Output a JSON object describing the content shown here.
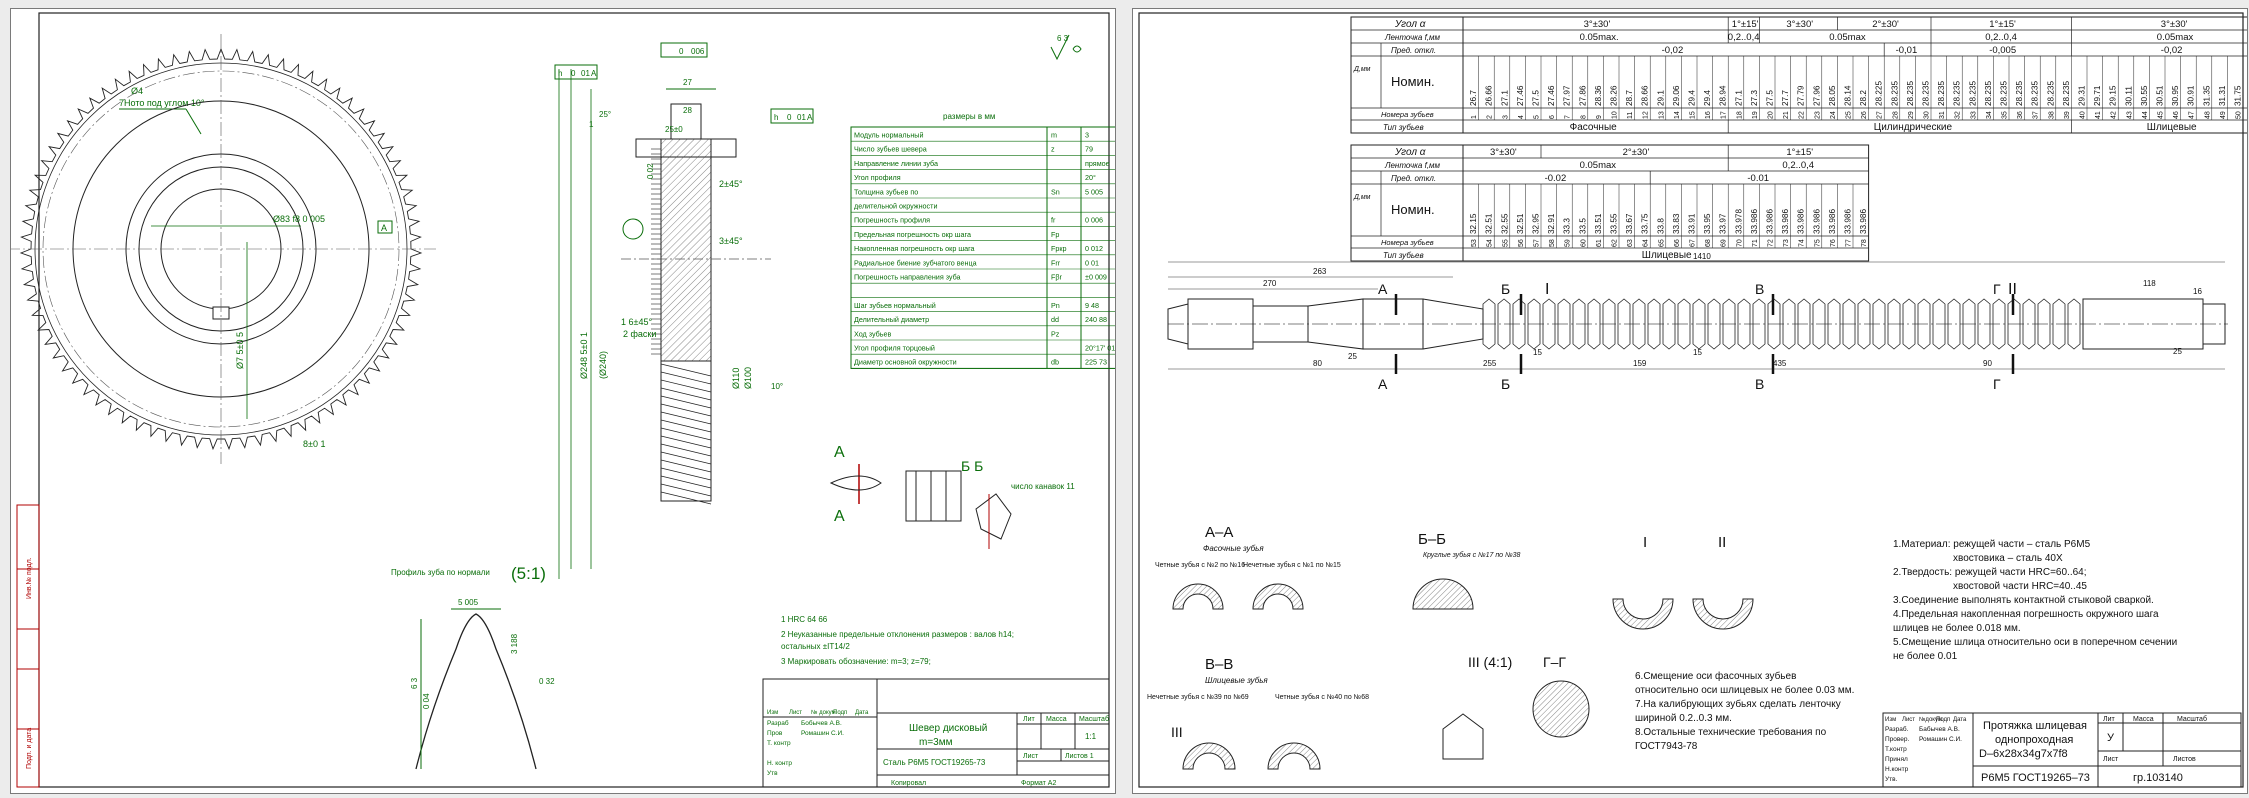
{
  "left_sheet": {
    "top_annotations": {
      "tooth_note": [
        "Ø4",
        "7Ното  под углом 10°"
      ],
      "tol_frame_1": [
        "h",
        "0",
        "01",
        "A"
      ],
      "tol_frame_2": [
        "",
        "0",
        "006"
      ],
      "tol_frame_3": [
        "h",
        "0",
        "01",
        "A"
      ],
      "dims": [
        "27",
        "28",
        "25±0",
        "1",
        "1",
        "25°"
      ]
    },
    "gear_dims": {
      "bore": "Ø83  f8  0  005",
      "datum": "A",
      "hub": "Ø7  5±0  5",
      "key": "8±0  1",
      "outer_a": "Ø248  5±0  1",
      "outer_b": "(Ø240)",
      "inner_a": "Ø110",
      "inner_b": "Ø100",
      "chamf1": "2±45°",
      "chamf2": "3±45°",
      "chamf3": "1  6±45°",
      "chamf4": "2 фаски",
      "side": "0  02",
      "angle": "10°"
    },
    "params": {
      "header": "размеры в мм",
      "rows": [
        [
          "Модуль нормальный",
          "m",
          "3"
        ],
        [
          "Число зубьев шевера",
          "z",
          "79"
        ],
        [
          "Направление линии зуба",
          "",
          "прямое"
        ],
        [
          "Угол профиля",
          "",
          "20°"
        ],
        [
          "Толщина зубьев   по",
          "Sn",
          "5   005"
        ],
        [
          "делительной окружности",
          "",
          ""
        ],
        [
          "Погрешность профиля",
          "fr",
          "0   006"
        ],
        [
          "Предельная погрешность окр   шага",
          "Fp",
          ""
        ],
        [
          "Накопленная погрешность окр   шага",
          "Fpкр",
          "0   012"
        ],
        [
          "Радиальное биение зубчатого венца",
          "Frr",
          "0   01"
        ],
        [
          "Погрешность направления зуба",
          "Fβr",
          "±0   009"
        ],
        [
          "",
          "",
          ""
        ],
        [
          "Шаг зубьев нормальный",
          "Pn",
          "9   48"
        ],
        [
          "Делительный диаметр",
          "dd",
          "240   88"
        ],
        [
          "Ход зубьев",
          "Pz",
          ""
        ],
        [
          "Угол профиля торцовый",
          "",
          "20°17'   01''"
        ],
        [
          "Диаметр основной окружности",
          "db",
          "225   73"
        ]
      ]
    },
    "section_labels": {
      "a": "А",
      "a2": "А",
      "bb": "Б  Б",
      "slots": "число канавок 11"
    },
    "notes": [
      "1    HRC  64       66",
      "2    Неуказанные предельные отклонения размеров : валов  h14;",
      "      остальных  ±IT14/2",
      "3    Маркировать обозначение: m=3; z=79;"
    ],
    "profile": {
      "title": "Профиль зуба по нормали",
      "scale": "(5:1)",
      "thick": "5   005",
      "h1": "3   188",
      "h2": "6   3",
      "r1": "0   32",
      "r2": "0   04"
    },
    "titleblock": {
      "cols": [
        "Изм",
        "Лист",
        "№ докум",
        "Подп",
        "Дата"
      ],
      "people": [
        [
          "Разраб",
          "Бобычев А.В."
        ],
        [
          "Пров",
          "Ромашин С.И."
        ],
        [
          "Т. контр",
          ""
        ],
        [
          "",
          ""
        ],
        [
          "Н. контр",
          ""
        ],
        [
          "Утв",
          ""
        ]
      ],
      "title1": "Шевер дисковый",
      "title2": "m=3мм",
      "std": "Сталь  Р6М5  ГОСТ19265-73",
      "lit": "Лит",
      "mass": "Масса",
      "scale_h": "Масштаб",
      "scale_v": "1:1",
      "sheet": "Лист",
      "sheets": "Листов  1",
      "copied": "Копировал",
      "format": "Формат  А2"
    },
    "rough": "6 3"
  },
  "right_sheet": {
    "table1": {
      "row_angle_label": "Угол α",
      "angle_vals": [
        "3°±30'",
        "1°±15'",
        "3°±30'",
        "2°±30'",
        "1°±15'",
        "3°±30'"
      ],
      "row_band_label": "Ленточка f,мм",
      "band_vals": [
        "0.05max.",
        "0,2..0,4",
        "0.05max",
        "0,2..0,4",
        "0.05max"
      ],
      "row_tol_label": "Пред. откл.",
      "tol_vals": [
        "-0,02",
        "-0,01",
        "-0,005",
        "-0,02"
      ],
      "dmm": "Д,мм",
      "nom": "Номин.",
      "row_num_label": "Номера зубьев",
      "row_type_label": "Тип зубьев",
      "types": [
        "Фасочные",
        "Цилиндрические",
        "Шлицевые"
      ],
      "cols": [
        [
          "1",
          "26.7"
        ],
        [
          "2",
          "26.66"
        ],
        [
          "3",
          "27.1"
        ],
        [
          "4",
          "27.46"
        ],
        [
          "5",
          "27.5"
        ],
        [
          "6",
          "27.46"
        ],
        [
          "7",
          "27.97"
        ],
        [
          "8",
          "27.86"
        ],
        [
          "9",
          "28.36"
        ],
        [
          "10",
          "28.26"
        ],
        [
          "11",
          "28.7"
        ],
        [
          "12",
          "28.66"
        ],
        [
          "13",
          "29.1"
        ],
        [
          "14",
          "29.06"
        ],
        [
          "15",
          "29.4"
        ],
        [
          "16",
          "29.4"
        ],
        [
          "17",
          "28.94"
        ],
        [
          "18",
          "27.1"
        ],
        [
          "19",
          "27.3"
        ],
        [
          "20",
          "27.5"
        ],
        [
          "21",
          "27.7"
        ],
        [
          "22",
          "27.79"
        ],
        [
          "23",
          "27.96"
        ],
        [
          "24",
          "28.05"
        ],
        [
          "25",
          "28.14"
        ],
        [
          "26",
          "28.2"
        ],
        [
          "27",
          "28.225"
        ],
        [
          "28",
          "28.235"
        ],
        [
          "29",
          "28.235"
        ],
        [
          "30",
          "28.235"
        ],
        [
          "31",
          "28.235"
        ],
        [
          "32",
          "28.235"
        ],
        [
          "33",
          "28.235"
        ],
        [
          "34",
          "28.235"
        ],
        [
          "35",
          "28.235"
        ],
        [
          "36",
          "28.235"
        ],
        [
          "37",
          "28.235"
        ],
        [
          "38",
          "28.235"
        ],
        [
          "39",
          "28.235"
        ],
        [
          "40",
          "29.31"
        ],
        [
          "41",
          "29.71"
        ],
        [
          "42",
          "29.15"
        ],
        [
          "43",
          "30.11"
        ],
        [
          "44",
          "30.55"
        ],
        [
          "45",
          "30.51"
        ],
        [
          "46",
          "30.95"
        ],
        [
          "47",
          "30.91"
        ],
        [
          "48",
          "31.35"
        ],
        [
          "49",
          "31.31"
        ],
        [
          "50",
          "31.75"
        ],
        [
          "51",
          "31.71"
        ],
        [
          "52",
          "32.11"
        ]
      ]
    },
    "table2": {
      "row_angle_label": "Угол α",
      "angle_vals": [
        "3°±30'",
        "2°±30'",
        "1°±15'"
      ],
      "row_band_label": "Ленточка f,мм",
      "band_vals": [
        "0.05max",
        "0,2..0,4"
      ],
      "row_tol_label": "Пред. откл.",
      "tol_vals": [
        "-0.02",
        "-0.01"
      ],
      "dmm": "Д,мм",
      "nom": "Номин.",
      "row_num_label": "Номера зубьев",
      "row_type_label": "Тип зубьев",
      "types": [
        "Шлицевые"
      ],
      "cols": [
        [
          "53",
          "32.15"
        ],
        [
          "54",
          "32.51"
        ],
        [
          "55",
          "32.55"
        ],
        [
          "56",
          "32.51"
        ],
        [
          "57",
          "32.95"
        ],
        [
          "58",
          "32.91"
        ],
        [
          "59",
          "33.3"
        ],
        [
          "60",
          "33.5"
        ],
        [
          "61",
          "33.51"
        ],
        [
          "62",
          "33.55"
        ],
        [
          "63",
          "33.67"
        ],
        [
          "64",
          "33.75"
        ],
        [
          "65",
          "33.8"
        ],
        [
          "66",
          "33.83"
        ],
        [
          "67",
          "33.91"
        ],
        [
          "68",
          "33.95"
        ],
        [
          "69",
          "33.97"
        ],
        [
          "70",
          "33.978"
        ],
        [
          "71",
          "33.986"
        ],
        [
          "72",
          "33.986"
        ],
        [
          "73",
          "33.986"
        ],
        [
          "74",
          "33.986"
        ],
        [
          "75",
          "33.986"
        ],
        [
          "76",
          "33.986"
        ],
        [
          "77",
          "33.986"
        ],
        [
          "78",
          "33.986"
        ]
      ]
    },
    "section_marks": [
      "А",
      "Б",
      "В",
      "Г",
      "А",
      "Б",
      "В",
      "Г"
    ],
    "callouts": [
      "I",
      "II"
    ],
    "dims": {
      "total": "1410",
      "d263": "263",
      "d270": "270",
      "d80": "80",
      "d255": "255",
      "d159": "159",
      "d435": "435",
      "d90": "90",
      "d25": "25",
      "d15a": "15",
      "d15b": "15",
      "d118": "118",
      "d16": "16",
      "d25b": "25"
    },
    "sections": {
      "aa": "А–А",
      "aa_sub": "Фасочные зубья",
      "aa_l": "Четные зубья с №2 по №16",
      "aa_r": "Нечетные зубья с №1 по №15",
      "bb": "Б–Б",
      "bb_sub": "Круглые зубья с №17 по №38",
      "vv": "В–В",
      "vv_sub": "Шлицевые зубья",
      "vv_l": "Нечетные зубья с №39 по №69",
      "vv_r": "Четные зубья с №40 по №68",
      "d1": "I",
      "d2": "II",
      "d3": "III (4:1)",
      "gg": "Г–Г",
      "iii": "III"
    },
    "notes_top": [
      "1.Материал: режущей части – сталь Р6М5",
      "хвостовика – сталь 40Х",
      "2.Твердость: режущей части HRC=60..64;",
      "хвостовой части HRC=40..45",
      "3.Соединение выполнять контактной стыковой сваркой.",
      "4.Предельная накопленная погрешность окружного шага",
      "шлицев не более 0.018 мм.",
      "5.Смещение шлица относительно оси в поперечном сечении",
      "не более 0.01"
    ],
    "notes_bottom": [
      "6.Смещение оси фасочных зубьев",
      "относительно оси шлицевых не более 0.03 мм.",
      "7.На калибрующих зубьях сделать ленточку",
      "шириной 0.2..0.3 мм.",
      "8.Остальные технические требования по",
      "ГОСТ7943-78"
    ],
    "titleblock": {
      "cols": [
        "Изм",
        "Лист",
        "№докум",
        "Подп",
        "Дата"
      ],
      "people": [
        [
          "Разраб.",
          "Бабычев А.В."
        ],
        [
          "Провер.",
          "Ромашин С.И."
        ],
        [
          "Т.контр",
          ""
        ],
        [
          "Принял",
          ""
        ],
        [
          "Н.контр",
          ""
        ],
        [
          "Утв.",
          ""
        ]
      ],
      "title": [
        "Протяжка шлицевая",
        "однопроходная",
        "D–6х28х34g7х7f8"
      ],
      "lit": "Лит",
      "mass": "Масса",
      "scale": "Масштаб",
      "u": "У",
      "sheet": "Лист",
      "sheets": "Листов",
      "material": "Р6М5  ГОСТ19265–73",
      "group": "гр.103140"
    }
  }
}
